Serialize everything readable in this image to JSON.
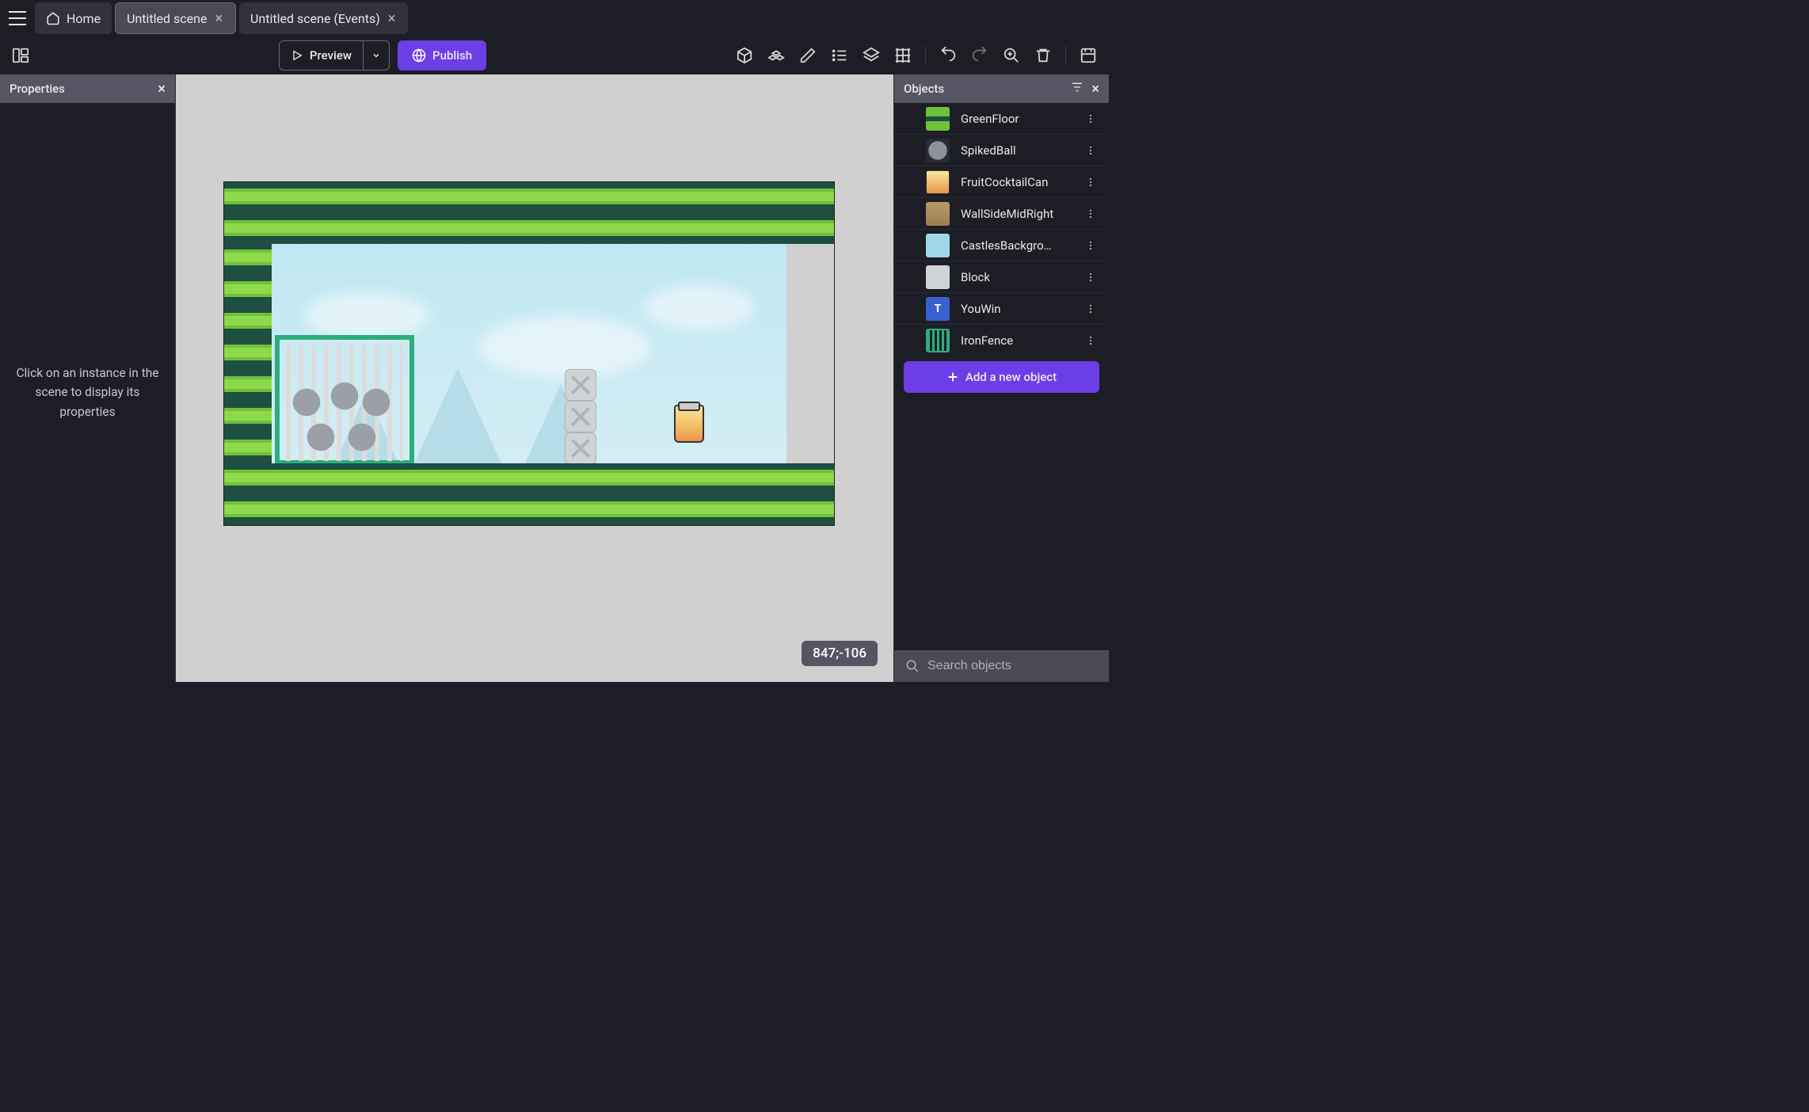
{
  "tabs": {
    "home": "Home",
    "scene": "Untitled scene",
    "events": "Untitled scene (Events)"
  },
  "toolbar": {
    "preview": "Preview",
    "publish": "Publish"
  },
  "properties": {
    "title": "Properties",
    "empty": "Click on an instance in the scene to display its properties"
  },
  "canvas": {
    "coords": "847;-106"
  },
  "objects": {
    "title": "Objects",
    "items": [
      {
        "name": "GreenFloor",
        "thumb": "th-grass"
      },
      {
        "name": "SpikedBall",
        "thumb": "th-spike"
      },
      {
        "name": "FruitCocktailCan",
        "thumb": "th-jar"
      },
      {
        "name": "WallSideMidRight",
        "thumb": "th-wall"
      },
      {
        "name": "CastlesBackgro…",
        "thumb": "th-sky"
      },
      {
        "name": "Block",
        "thumb": "th-block"
      },
      {
        "name": "YouWin",
        "thumb": "th-text"
      },
      {
        "name": "IronFence",
        "thumb": "th-fence"
      }
    ],
    "add_label": "Add a new object",
    "search_placeholder": "Search objects"
  }
}
